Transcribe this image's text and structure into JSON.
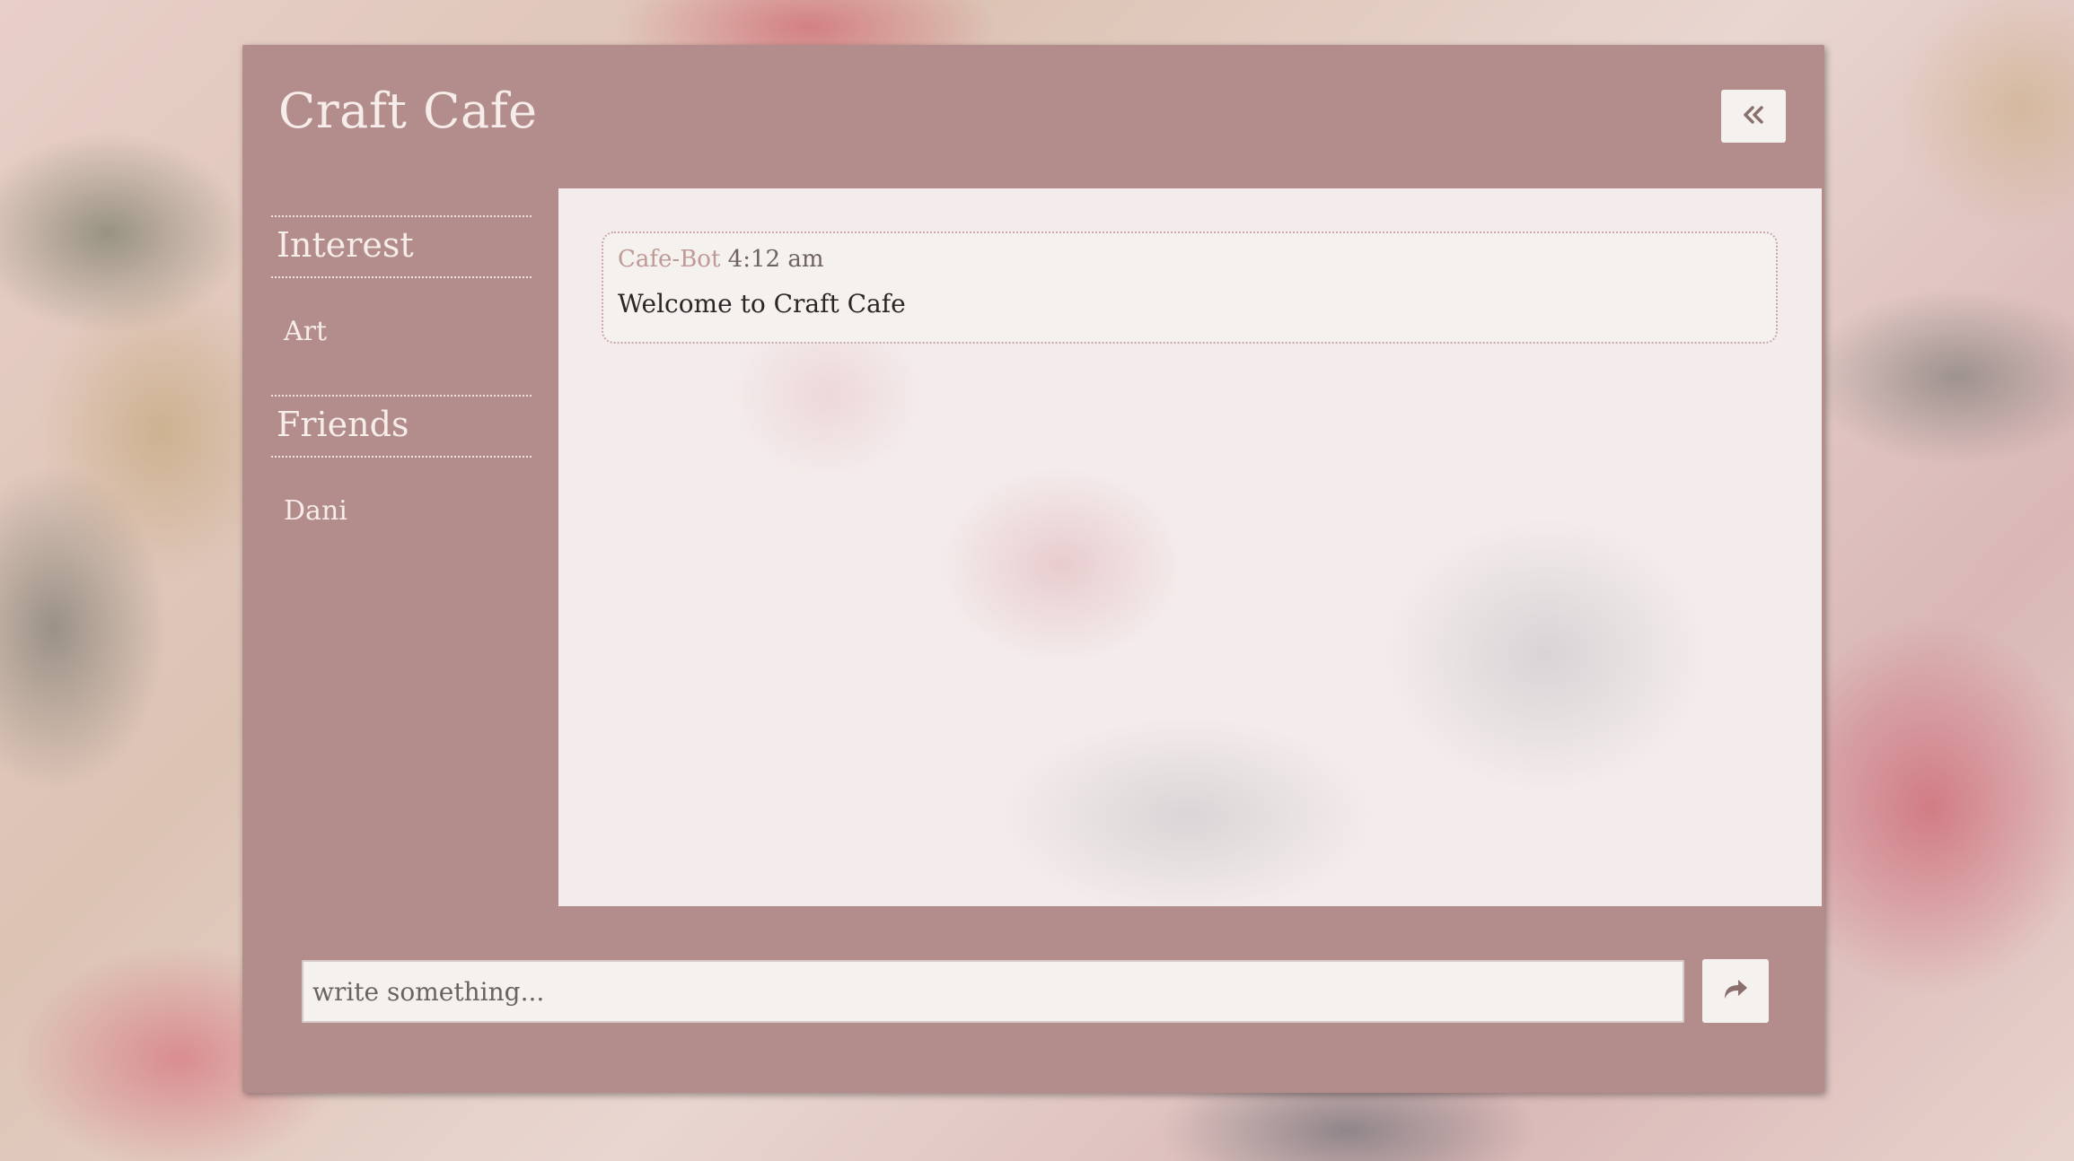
{
  "app": {
    "title": "Craft Cafe",
    "collapse_icon": "double-chevron-left-icon"
  },
  "sidebar": {
    "sections": [
      {
        "title": "Interest",
        "items": [
          "Art"
        ]
      },
      {
        "title": "Friends",
        "items": [
          "Dani"
        ]
      }
    ]
  },
  "chat": {
    "messages": [
      {
        "sender": "Cafe-Bot",
        "time": "4:12 am",
        "text": "Welcome to Craft Cafe"
      }
    ]
  },
  "composer": {
    "placeholder": "write something...",
    "value": "",
    "send_icon": "share-arrow-icon"
  },
  "colors": {
    "panel": "#b38d8b",
    "sender": "#bf9995",
    "surface": "#f4f1ef"
  }
}
